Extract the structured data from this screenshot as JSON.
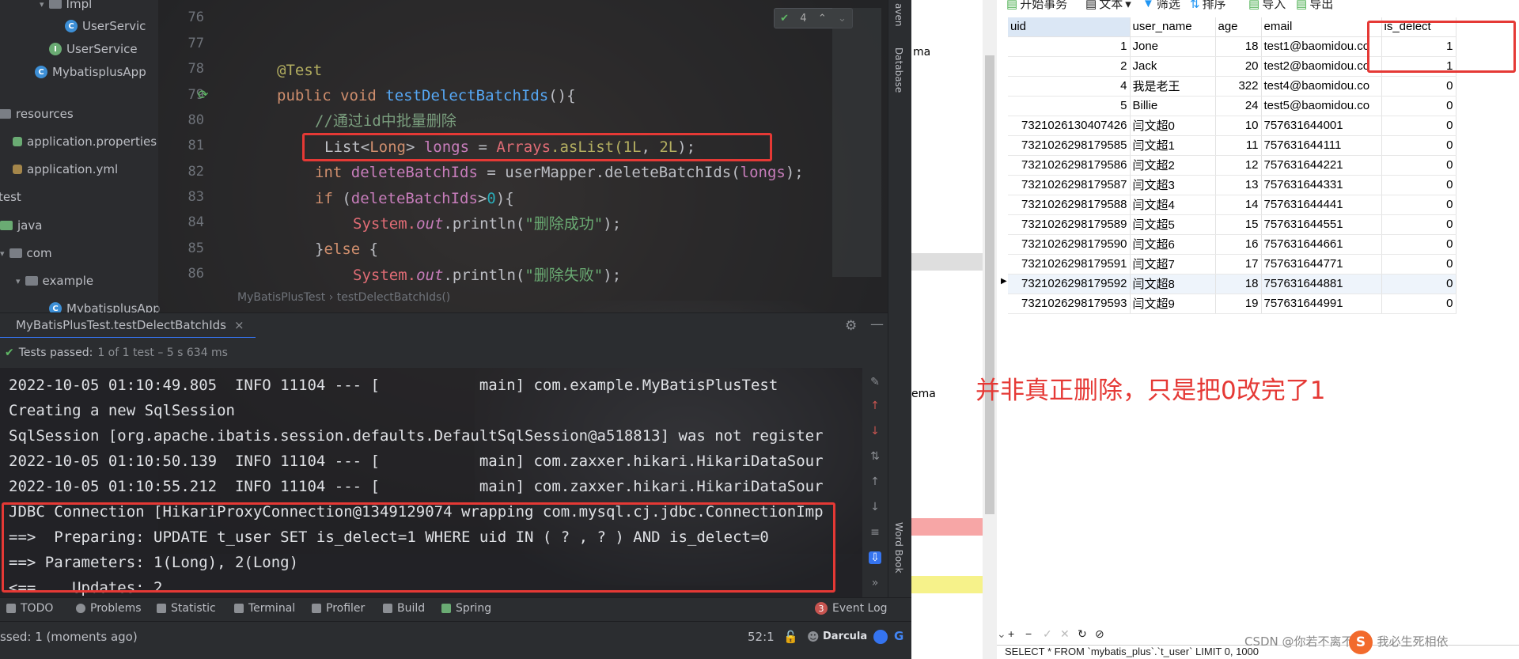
{
  "project_tree": {
    "items": [
      {
        "label": "Impl",
        "icon": "folder-icon"
      },
      {
        "label": "UserServic",
        "icon": "class-icon"
      },
      {
        "label": "UserService",
        "icon": "interface-icon"
      },
      {
        "label": "MybatisplusApp",
        "icon": "class-icon"
      },
      {
        "label": "resources",
        "icon": "folder-icon"
      },
      {
        "label": "application.properties",
        "icon": "properties-icon"
      },
      {
        "label": "application.yml",
        "icon": "yaml-icon"
      },
      {
        "label": "test",
        "icon": "folder-icon"
      },
      {
        "label": "java",
        "icon": "folder-icon"
      },
      {
        "label": "com",
        "icon": "folder-icon"
      },
      {
        "label": "example",
        "icon": "folder-icon"
      },
      {
        "label": "MybatisplusApp",
        "icon": "class-icon"
      }
    ]
  },
  "editor": {
    "line_numbers": [
      "76",
      "77",
      "78",
      "79",
      "80",
      "81",
      "82",
      "83",
      "84",
      "85",
      "86"
    ],
    "inspection_count": "4",
    "breadcrumb": [
      "MyBatisPlusTest",
      "testDelectBatchIds()"
    ],
    "code": {
      "annotation": "@Test",
      "l79_kw": "public void",
      "l79_fn": "testDelectBatchIds",
      "l79_rest": "(){",
      "l80": "//通过id中批量删除",
      "l81_a": "List<",
      "l81_b": "Long",
      "l81_c": "> ",
      "l81_d": "longs",
      "l81_e": " = ",
      "l81_f": "Arrays",
      "l81_g": ".asList(",
      "l81_h": "1L",
      "l81_i": ", ",
      "l81_j": "2L",
      "l81_k": ");",
      "l82_a": "int ",
      "l82_b": "deleteBatchIds",
      "l82_c": " = userMapper.deleteBatchIds(",
      "l82_d": "longs",
      "l82_e": ");",
      "l83_a": "if ",
      "l83_b": "(",
      "l83_c": "deleteBatchIds",
      "l83_d": ">",
      "l83_e": "0",
      "l83_f": "){",
      "l84_a": "System.",
      "l84_b": "out",
      "l84_c": ".println(",
      "l84_d": "\"删除成功\"",
      "l84_e": ");",
      "l85_a": "}",
      "l85_b": "else",
      "l85_c": " {",
      "l86_a": "System.",
      "l86_b": "out",
      "l86_c": ".println(",
      "l86_d": "\"删除失败\"",
      "l86_e": ");"
    }
  },
  "right_toolbar": {
    "maven": "aven",
    "database": "Database",
    "word_book": "Word Book"
  },
  "run": {
    "tab_label": "MyBatisPlusTest.testDelectBatchIds",
    "tests_passed": "Tests passed:",
    "tests_detail": "1 of 1 test – 5 s 634 ms",
    "console_lines": [
      "2022-10-05 01:10:49.805  INFO 11104 --- [           main] com.example.MyBatisPlusTest",
      "Creating a new SqlSession",
      "SqlSession [org.apache.ibatis.session.defaults.DefaultSqlSession@a518813] was not register",
      "2022-10-05 01:10:50.139  INFO 11104 --- [           main] com.zaxxer.hikari.HikariDataSour",
      "2022-10-05 01:10:55.212  INFO 11104 --- [           main] com.zaxxer.hikari.HikariDataSour",
      "JDBC Connection [HikariProxyConnection@1349129074 wrapping com.mysql.cj.jdbc.ConnectionImp",
      "==>  Preparing: UPDATE t_user SET is_delect=1 WHERE uid IN ( ? , ? ) AND is_delect=0",
      "==> Parameters: 1(Long), 2(Long)",
      "<==    Updates: 2"
    ]
  },
  "bottom_tabs": [
    "TODO",
    "Problems",
    "Statistic",
    "Terminal",
    "Profiler",
    "Build",
    "Spring",
    "Event Log"
  ],
  "event_log_count": "3",
  "status": {
    "left": "ssed: 1 (moments ago)",
    "position": "52:1",
    "theme": "Darcula"
  },
  "mid_strip": {
    "t1": "ma",
    "t2": "ema"
  },
  "db": {
    "toolbar": [
      "开始事务",
      "文本",
      "筛选",
      "排序",
      "导入",
      "导出"
    ],
    "columns": [
      "uid",
      "user_name",
      "age",
      "email",
      "is_delect"
    ],
    "rows": [
      [
        "1",
        "Jone",
        "18",
        "test1@baomidou.co",
        "1"
      ],
      [
        "2",
        "Jack",
        "20",
        "test2@baomidou.co",
        "1"
      ],
      [
        "4",
        "我是老王",
        "322",
        "test4@baomidou.co",
        "0"
      ],
      [
        "5",
        "Billie",
        "24",
        "test5@baomidou.co",
        "0"
      ],
      [
        "7321026130407426",
        "闫文超0",
        "10",
        "757631644001",
        "0"
      ],
      [
        "7321026298179585",
        "闫文超1",
        "11",
        "757631644111",
        "0"
      ],
      [
        "7321026298179586",
        "闫文超2",
        "12",
        "757631644221",
        "0"
      ],
      [
        "7321026298179587",
        "闫文超3",
        "13",
        "757631644331",
        "0"
      ],
      [
        "7321026298179588",
        "闫文超4",
        "14",
        "757631644441",
        "0"
      ],
      [
        "7321026298179589",
        "闫文超5",
        "15",
        "757631644551",
        "0"
      ],
      [
        "7321026298179590",
        "闫文超6",
        "16",
        "757631644661",
        "0"
      ],
      [
        "7321026298179591",
        "闫文超7",
        "17",
        "757631644771",
        "0"
      ],
      [
        "7321026298179592",
        "闫文超8",
        "18",
        "757631644881",
        "0"
      ],
      [
        "7321026298179593",
        "闫文超9",
        "19",
        "757631644991",
        "0"
      ]
    ],
    "bottom_buttons": [
      "+",
      "−",
      "✓",
      "✕",
      "↻",
      "⊘"
    ],
    "sql": "SELECT * FROM `mybatis_plus`.`t_user` LIMIT 0, 1000"
  },
  "annotation": "并非真正删除，只是把0改完了1",
  "watermark": "CSDN @你若不离不弃，我必生死相依",
  "colors": {
    "accent_red": "#e53935",
    "ide_bg": "#2b2d30"
  }
}
